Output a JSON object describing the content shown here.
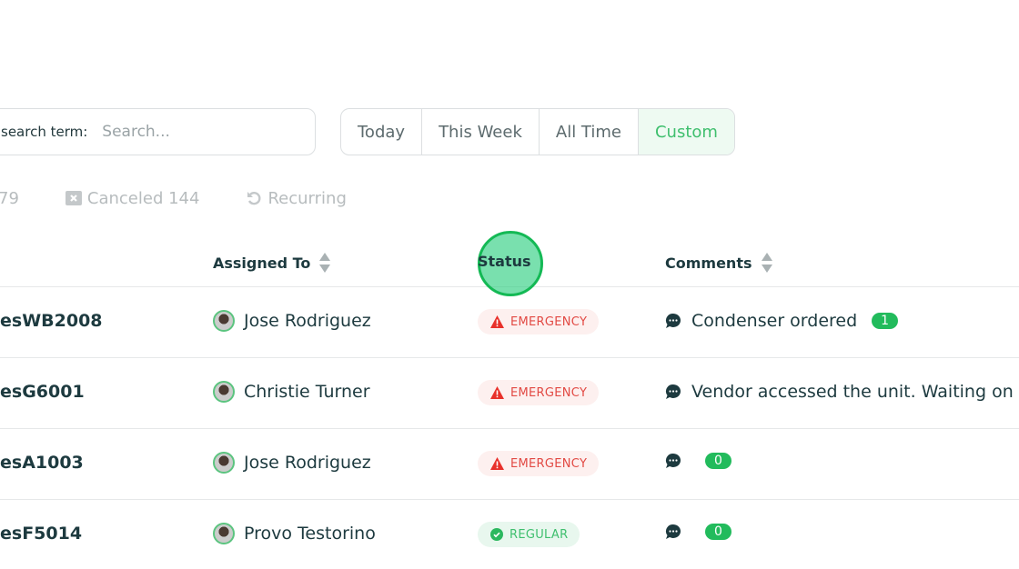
{
  "search": {
    "label": "search term:",
    "placeholder": "Search..."
  },
  "date_range": {
    "options": [
      "Today",
      "This Week",
      "All Time",
      "Custom"
    ],
    "selected": "Custom"
  },
  "filters": {
    "partial_count": "79",
    "canceled_label": "Canceled 144",
    "recurring_label": "Recurring"
  },
  "table": {
    "headers": {
      "assigned_to": "Assigned To",
      "status": "Status",
      "comments": "Comments"
    },
    "rows": [
      {
        "id": "esWB2008",
        "assignee": "Jose Rodriguez",
        "status": "EMERGENCY",
        "comment": "Condenser ordered",
        "count": "1"
      },
      {
        "id": "esG6001",
        "assignee": "Christie Turner",
        "status": "EMERGENCY",
        "comment": "Vendor accessed the unit. Waiting on e",
        "count": ""
      },
      {
        "id": "esA1003",
        "assignee": "Jose Rodriguez",
        "status": "EMERGENCY",
        "comment": "",
        "count": "0"
      },
      {
        "id": "esF5014",
        "assignee": "Provo Testorino",
        "status": "REGULAR",
        "comment": "",
        "count": "0"
      }
    ]
  },
  "colors": {
    "accent": "#3fbf6e",
    "emergency": "#e24a44",
    "badge": "#22bb5c",
    "text": "#1d3a3f"
  }
}
